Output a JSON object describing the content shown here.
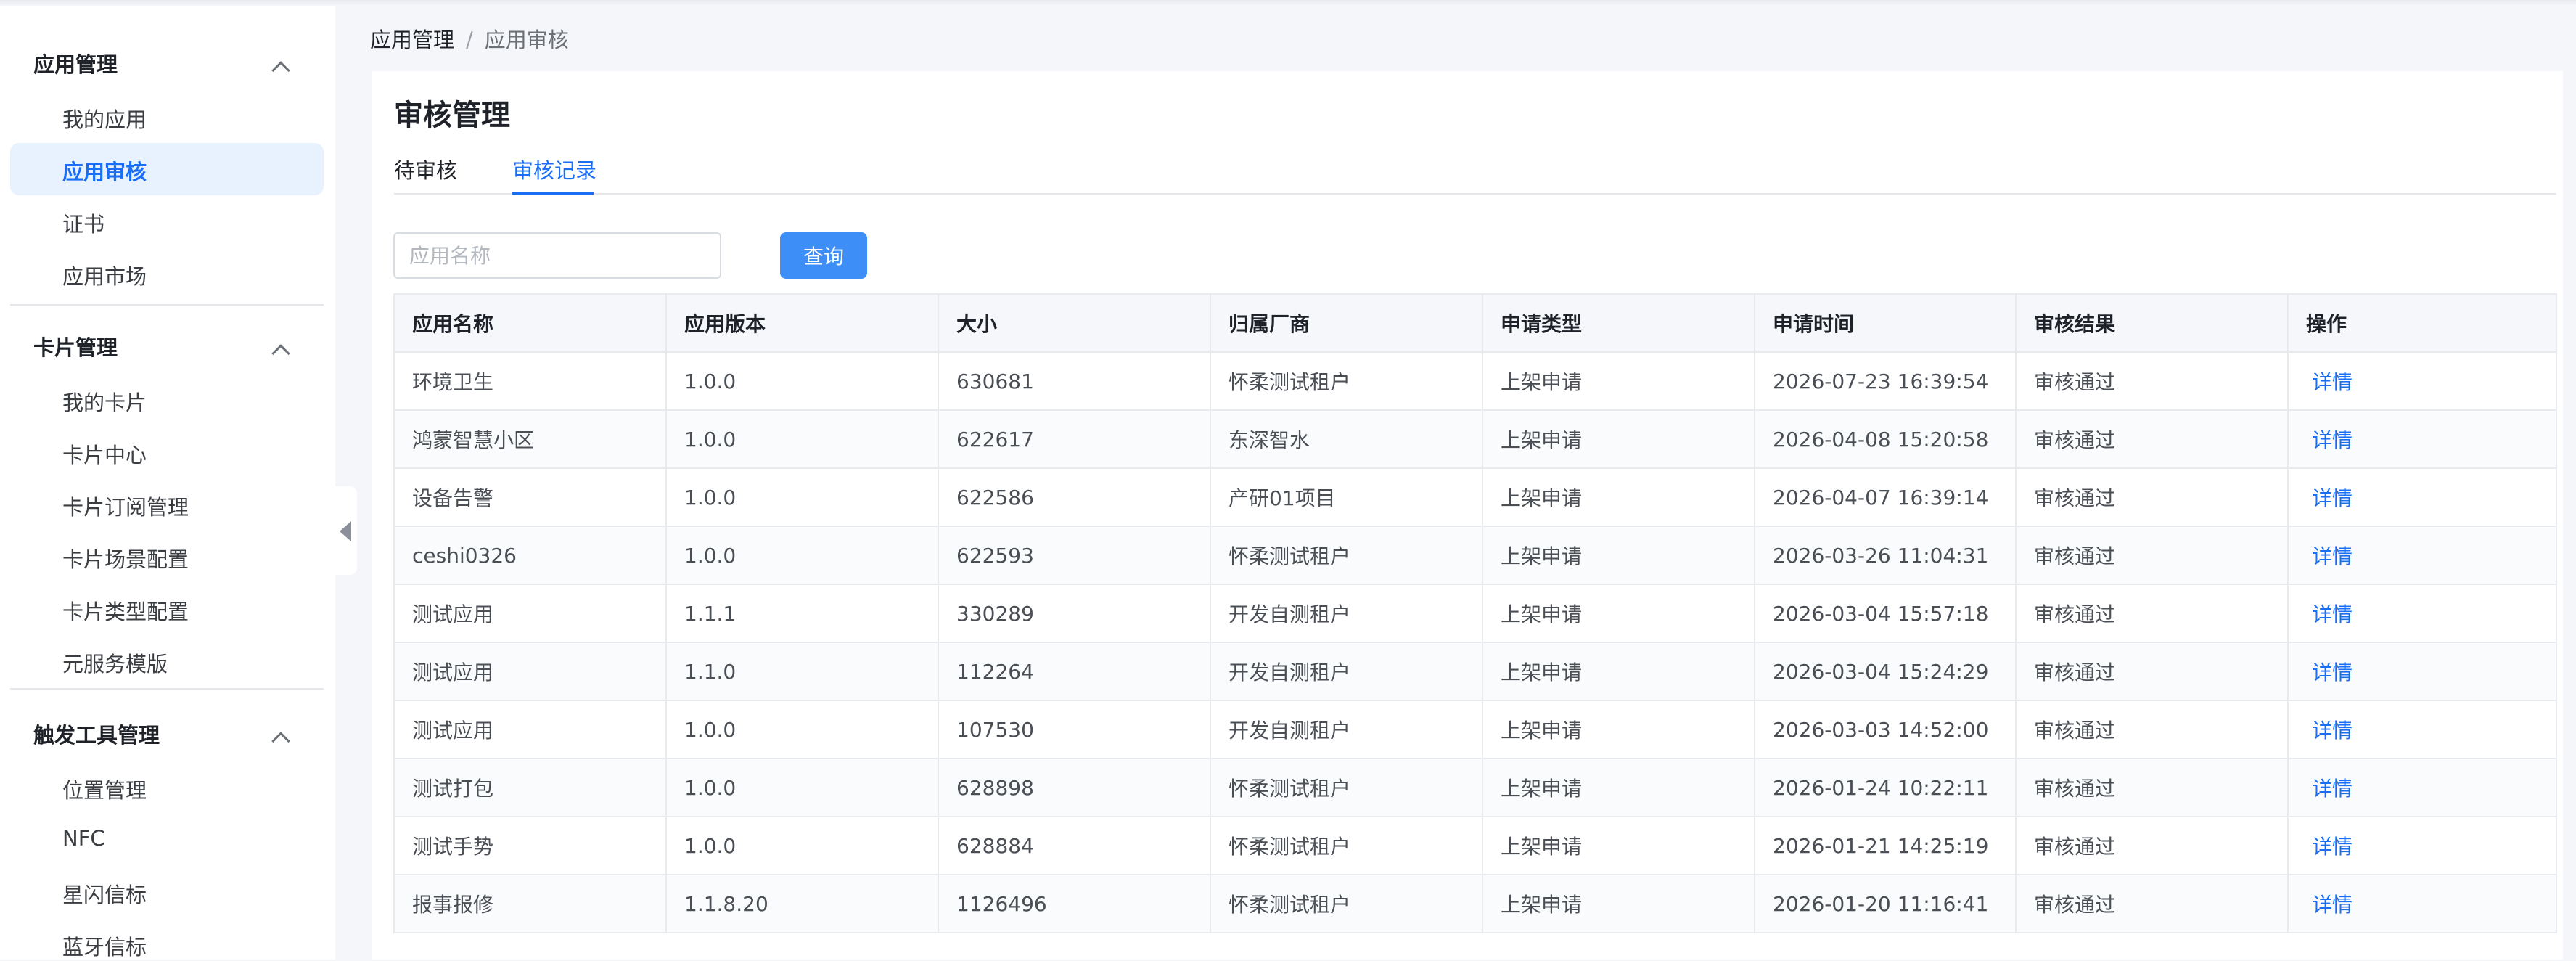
{
  "sidebar": {
    "groups": [
      {
        "title": "应用管理",
        "items": [
          "我的应用",
          "应用审核",
          "证书",
          "应用市场"
        ]
      },
      {
        "title": "卡片管理",
        "items": [
          "我的卡片",
          "卡片中心",
          "卡片订阅管理",
          "卡片场景配置",
          "卡片类型配置",
          "元服务模版"
        ]
      },
      {
        "title": "触发工具管理",
        "items": [
          "位置管理",
          "NFC",
          "星闪信标",
          "蓝牙信标"
        ]
      }
    ],
    "active_item": "应用审核"
  },
  "breadcrumb": {
    "root": "应用管理",
    "separator": "/",
    "current": "应用审核"
  },
  "page_title": "审核管理",
  "tabs": [
    {
      "label": "待审核"
    },
    {
      "label": "审核记录",
      "active": true
    }
  ],
  "search": {
    "placeholder": "应用名称",
    "value": "",
    "button_label": "查询"
  },
  "table": {
    "headers": [
      "应用名称",
      "应用版本",
      "大小",
      "归属厂商",
      "申请类型",
      "申请时间",
      "审核结果",
      "操作"
    ],
    "rows": [
      [
        "环境卫生",
        "1.0.0",
        "630681",
        "怀柔测试租户",
        "上架申请",
        "2026-07-23 16:39:54",
        "审核通过",
        "详情"
      ],
      [
        "鸿蒙智慧小区",
        "1.0.0",
        "622617",
        "东深智水",
        "上架申请",
        "2026-04-08 15:20:58",
        "审核通过",
        "详情"
      ],
      [
        "设备告警",
        "1.0.0",
        "622586",
        "产研01项目",
        "上架申请",
        "2026-04-07 16:39:14",
        "审核通过",
        "详情"
      ],
      [
        "ceshi0326",
        "1.0.0",
        "622593",
        "怀柔测试租户",
        "上架申请",
        "2026-03-26 11:04:31",
        "审核通过",
        "详情"
      ],
      [
        "测试应用",
        "1.1.1",
        "330289",
        "开发自测租户",
        "上架申请",
        "2026-03-04 15:57:18",
        "审核通过",
        "详情"
      ],
      [
        "测试应用",
        "1.1.0",
        "112264",
        "开发自测租户",
        "上架申请",
        "2026-03-04 15:24:29",
        "审核通过",
        "详情"
      ],
      [
        "测试应用",
        "1.0.0",
        "107530",
        "开发自测租户",
        "上架申请",
        "2026-03-03 14:52:00",
        "审核通过",
        "详情"
      ],
      [
        "测试打包",
        "1.0.0",
        "628898",
        "怀柔测试租户",
        "上架申请",
        "2026-01-24 10:22:11",
        "审核通过",
        "详情"
      ],
      [
        "测试手势",
        "1.0.0",
        "628884",
        "怀柔测试租户",
        "上架申请",
        "2026-01-21 14:25:19",
        "审核通过",
        "详情"
      ],
      [
        "报事报修",
        "1.1.8.20",
        "1126496",
        "怀柔测试租户",
        "上架申请",
        "2026-01-20 11:16:41",
        "审核通过",
        "详情"
      ]
    ]
  },
  "colors": {
    "accent": "#1a6ef5",
    "button": "#3d8ff7",
    "active_bg": "#e8f1fe"
  },
  "icons": {
    "group_toggle": "chevron-up-icon",
    "sidebar_collapse": "collapse-left-icon"
  }
}
